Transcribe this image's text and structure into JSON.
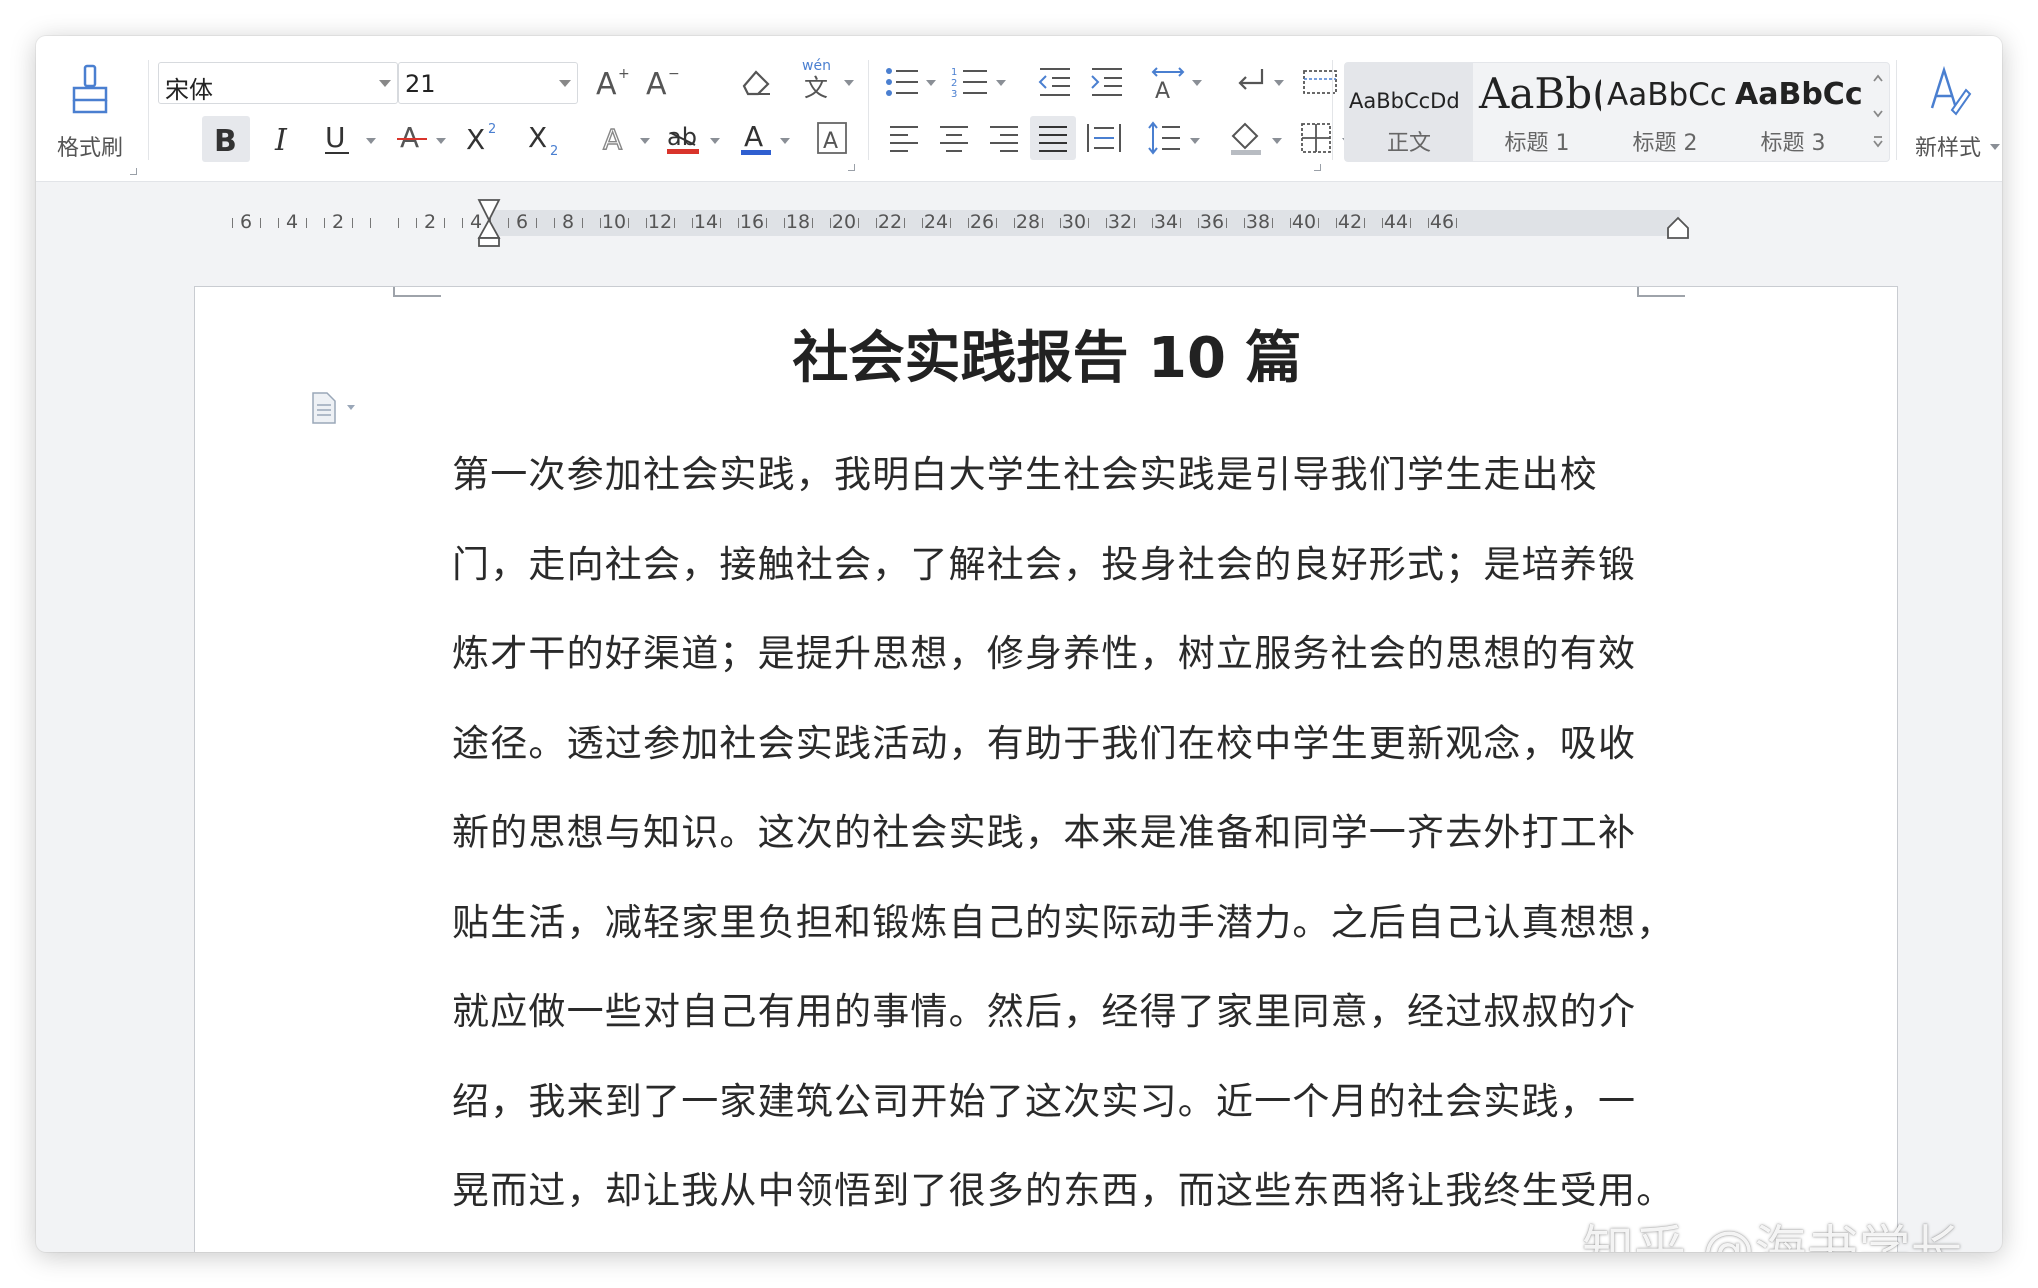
{
  "toolbar": {
    "format_painter_label": "格式刷",
    "font_name": "宋体",
    "font_size": "21",
    "phonetic_glyph": "wén",
    "styles": [
      {
        "sample": "AaBbCcDd",
        "name": "正文"
      },
      {
        "sample": "AaBb(",
        "name": "标题 1"
      },
      {
        "sample": "AaBbCc",
        "name": "标题 2"
      },
      {
        "sample": "AaBbCc",
        "name": "标题 3"
      }
    ],
    "new_style_label": "新样式"
  },
  "ruler": {
    "labels": [
      "6",
      "4",
      "2",
      "",
      "2",
      "4",
      "6",
      "8",
      "10",
      "12",
      "14",
      "16",
      "18",
      "20",
      "22",
      "24",
      "26",
      "28",
      "30",
      "32",
      "34",
      "36",
      "38",
      "40",
      "42",
      "44",
      "46"
    ]
  },
  "document": {
    "title": "社会实践报告 10 篇",
    "lines": [
      "第一次参加社会实践，我明白大学生社会实践是引导我们学生走出校",
      "门，走向社会，接触社会，了解社会，投身社会的良好形式；是培养锻",
      "炼才干的好渠道；是提升思想，修身养性，树立服务社会的思想的有效",
      "途径。透过参加社会实践活动，有助于我们在校中学生更新观念，吸收",
      "新的思想与知识。这次的社会实践，本来是准备和同学一齐去外打工补",
      "贴生活，减轻家里负担和锻炼自己的实际动手潜力。之后自己认真想想，",
      "就应做一些对自己有用的事情。然后，经得了家里同意，经过叔叔的介",
      "绍，我来到了一家建筑公司开始了这次实习。近一个月的社会实践，一",
      "晃而过，却让我从中领悟到了很多的东西，而这些东西将让我终生受用。"
    ]
  },
  "watermark": "知乎 @海书学长"
}
